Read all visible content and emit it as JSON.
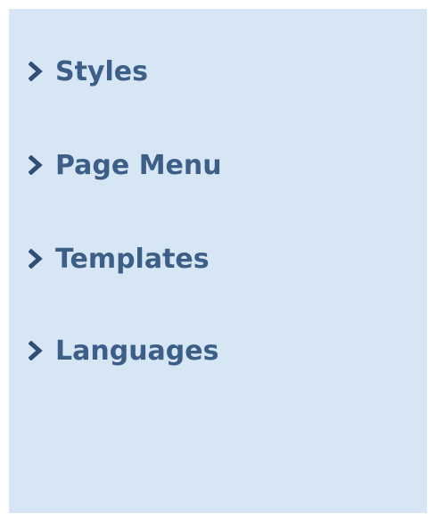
{
  "menu": {
    "items": [
      {
        "label": "Styles"
      },
      {
        "label": "Page Menu"
      },
      {
        "label": "Templates"
      },
      {
        "label": "Languages"
      }
    ]
  },
  "colors": {
    "panel_background": "#d6e6f5",
    "text": "#3d5f87",
    "chevron": "#2f4f78"
  },
  "icons": {
    "item_marker": "chevron-right-icon"
  }
}
